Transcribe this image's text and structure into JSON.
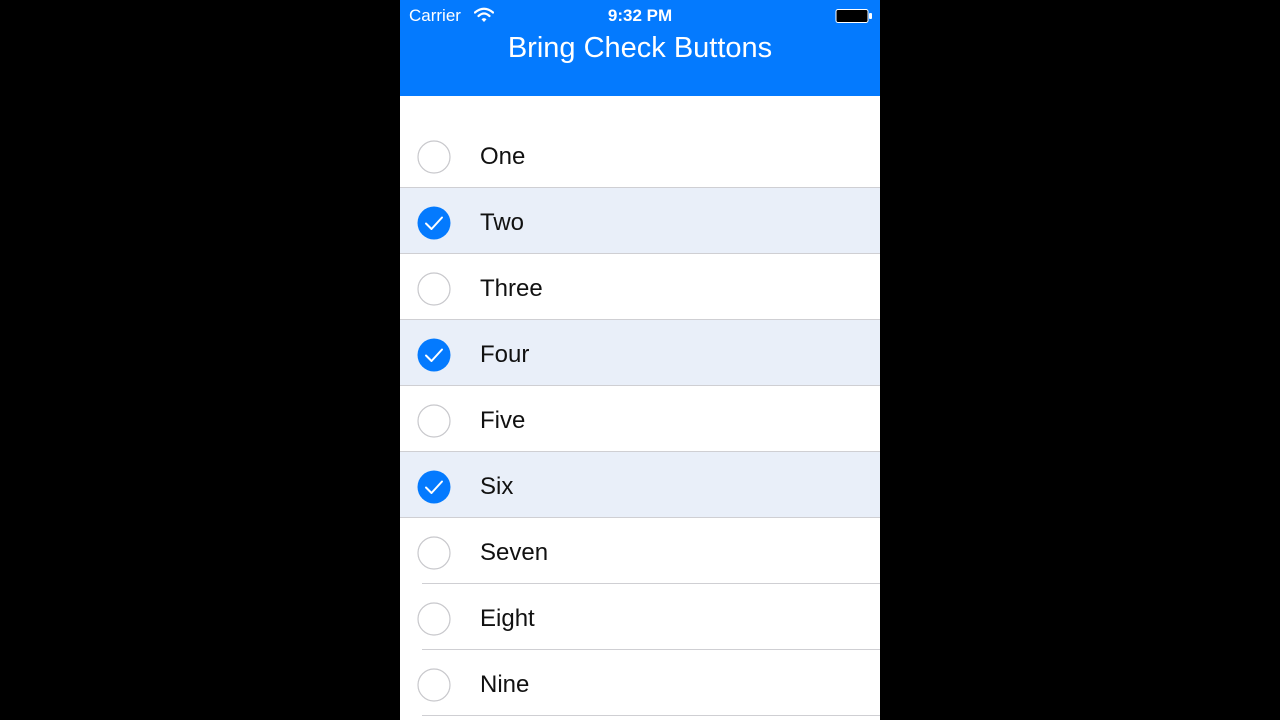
{
  "status_bar": {
    "carrier": "Carrier",
    "time": "9:32 PM"
  },
  "nav": {
    "title": "Bring Check Buttons"
  },
  "colors": {
    "accent": "#047afe",
    "checked_row_bg": "#e9eff9",
    "unchecked_ring": "#c8c8cc"
  },
  "items": [
    {
      "label": "One",
      "checked": false
    },
    {
      "label": "Two",
      "checked": true
    },
    {
      "label": "Three",
      "checked": false
    },
    {
      "label": "Four",
      "checked": true
    },
    {
      "label": "Five",
      "checked": false
    },
    {
      "label": "Six",
      "checked": true
    },
    {
      "label": "Seven",
      "checked": false
    },
    {
      "label": "Eight",
      "checked": false
    },
    {
      "label": "Nine",
      "checked": false
    }
  ]
}
